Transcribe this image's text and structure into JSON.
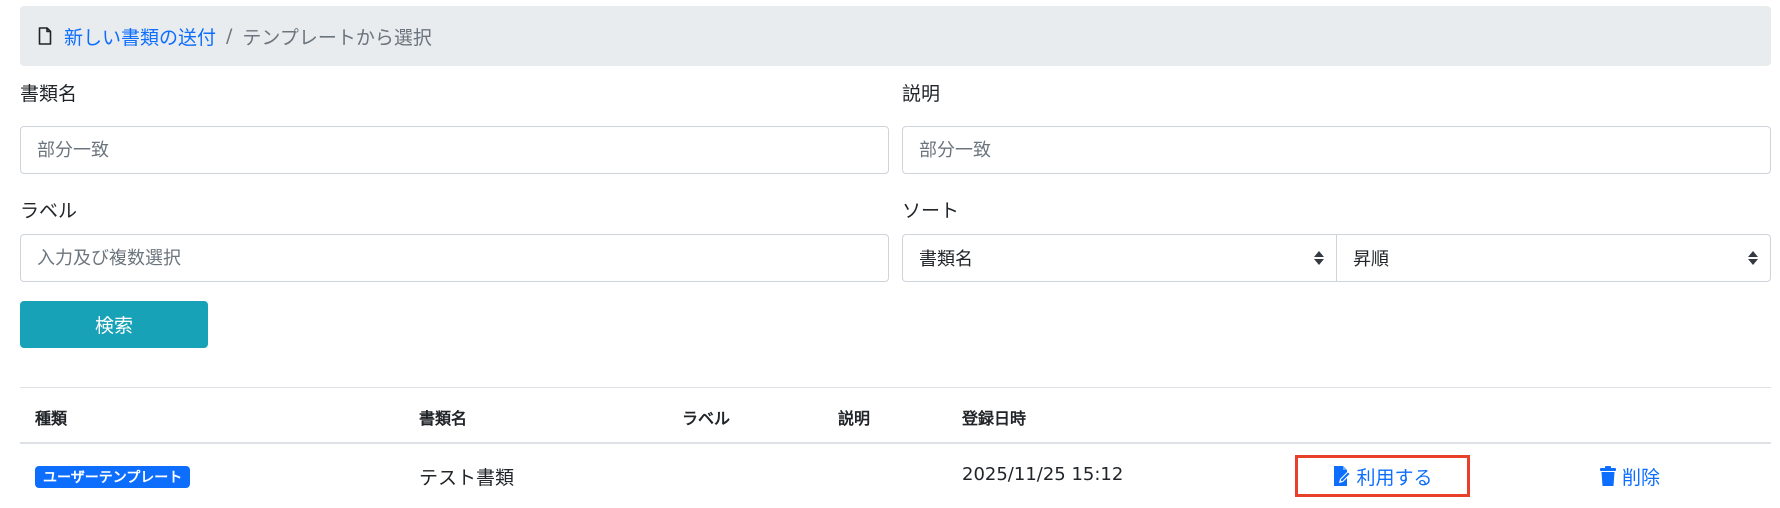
{
  "breadcrumb": {
    "icon": "document-icon",
    "link_label": "新しい書類の送付",
    "separator": "/",
    "current_label": "テンプレートから選択"
  },
  "form": {
    "doc_name": {
      "label": "書類名",
      "placeholder": "部分一致"
    },
    "description": {
      "label": "説明",
      "placeholder": "部分一致"
    },
    "labels": {
      "label": "ラベル",
      "placeholder": "入力及び複数選択"
    },
    "sort": {
      "label": "ソート",
      "field_value": "書類名",
      "order_value": "昇順"
    },
    "search_button_label": "検索"
  },
  "table": {
    "headers": {
      "type": "種類",
      "doc_name": "書類名",
      "label": "ラベル",
      "description": "説明",
      "registered_at": "登録日時"
    },
    "rows": [
      {
        "type_badge": "ユーザーテンプレート",
        "doc_name": "テスト書類",
        "label": "",
        "description": "",
        "registered_at": "2025/11/25 15:12",
        "use_label": "利用する",
        "delete_label": "削除"
      }
    ]
  },
  "colors": {
    "link": "#0d6efd",
    "search_button": "#17a2b8",
    "badge": "#0d6efd",
    "highlight_border": "#e8402b",
    "breadcrumb_bg": "#e9ecef"
  }
}
